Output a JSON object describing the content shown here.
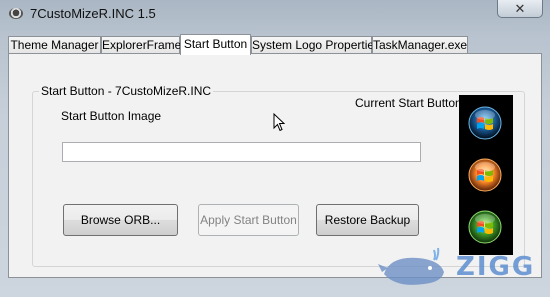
{
  "window": {
    "title": "7CustoMizeR.INC 1.5",
    "close_glyph": "✕"
  },
  "tabs": [
    {
      "label": "Theme Manager",
      "active": false
    },
    {
      "label": "ExplorerFrame",
      "active": false
    },
    {
      "label": "Start Button",
      "active": true
    },
    {
      "label": "System Logo Properties",
      "active": false
    },
    {
      "label": "TaskManager.exe",
      "active": false
    }
  ],
  "start_button_panel": {
    "group_title": "Start Button - 7CustoMizeR.INC",
    "image_label": "Start Button Image",
    "current_label": "Current Start Button",
    "path_value": "",
    "browse_label": "Browse ORB...",
    "apply_label": "Apply Start Button",
    "restore_label": "Restore Backup",
    "orb_states": [
      "normal",
      "hover",
      "pressed"
    ]
  },
  "watermark": {
    "text": "ZIGG",
    "icon": "whale-icon"
  },
  "colors": {
    "orb_glow": "#2fa6ff",
    "watermark": "#5d8fcf"
  }
}
